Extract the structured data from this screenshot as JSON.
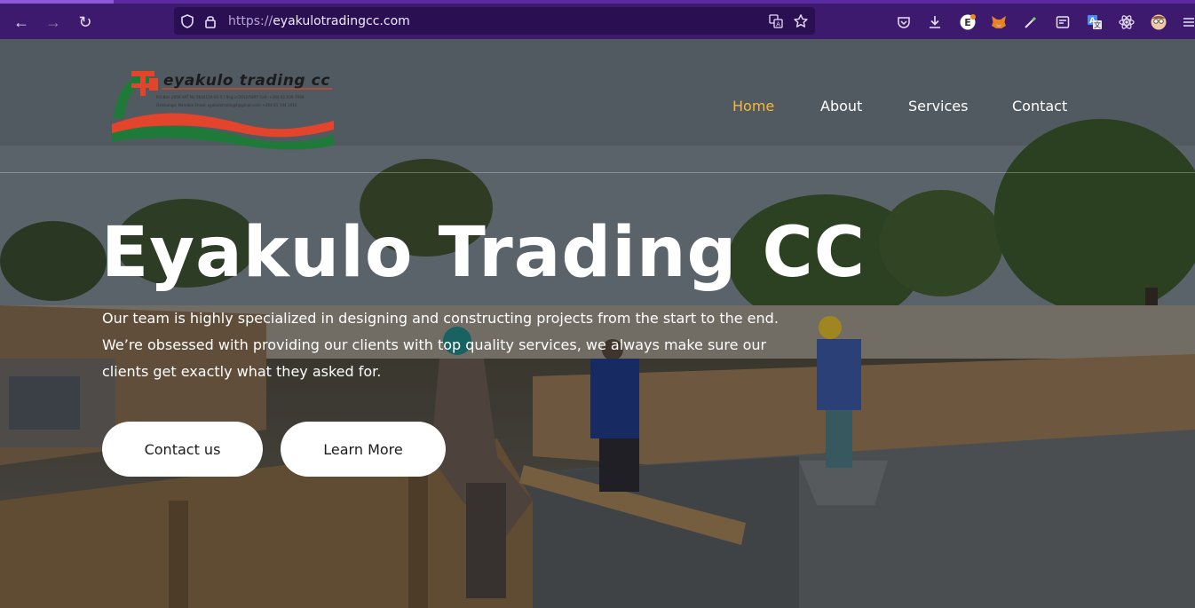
{
  "browser": {
    "url_prefix": "https://",
    "url_host": "eyakulotradingcc.com",
    "icons": [
      "back-icon",
      "forward-icon",
      "reload-icon",
      "shield-icon",
      "lock-icon",
      "translate-icon",
      "bookmark-star-icon",
      "pocket-icon",
      "download-icon",
      "extension-e-icon",
      "metamask-fox-icon",
      "color-picker-icon",
      "reader-icon",
      "translate-extension-icon",
      "react-devtools-icon",
      "profile-avatar-icon",
      "overflow-menu-icon"
    ]
  },
  "site": {
    "logo": {
      "name": "eyakulo trading cc",
      "line1": "P.O.Box 2059     VAT No 5644150-01-5 / Reg.cc2012/1897     Cell: +264 81 039 7998",
      "line2": "Oshikango, Namibia     Email: eyakulotrading4@gmail.com     +264 81 144 1910"
    },
    "nav": [
      {
        "label": "Home",
        "active": true
      },
      {
        "label": "About",
        "active": false
      },
      {
        "label": "Services",
        "active": false
      },
      {
        "label": "Contact",
        "active": false
      }
    ],
    "hero": {
      "title": "Eyakulo Trading CC",
      "text": "Our team is highly specialized in designing and constructing projects from the start to the end. We’re obsessed with providing our clients with top quality services, we always make sure our clients get exactly what they asked for.",
      "buttons": {
        "contact": "Contact us",
        "learn": "Learn More"
      }
    },
    "colors": {
      "accent": "#f5b938",
      "chrome": "#3d1a6e",
      "logo_red": "#e2452b",
      "logo_green": "#1f7a3a"
    }
  }
}
